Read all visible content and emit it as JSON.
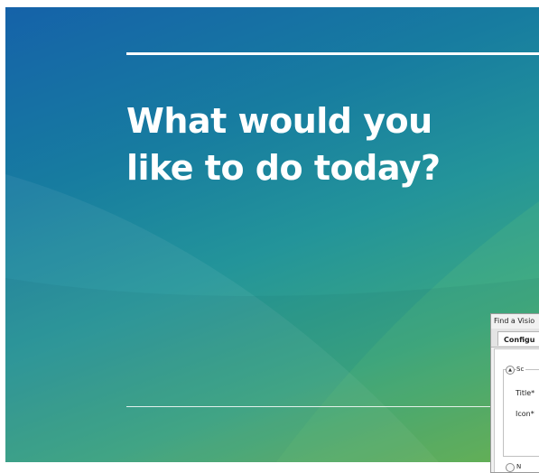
{
  "hero": {
    "headline_line1": "What would you",
    "headline_line2": "like to do today?"
  },
  "dialog": {
    "title": "Find a Visio",
    "tab_label": "Configu",
    "section_legend": "Sc",
    "title_label": "Title*",
    "icon_label": "Icon*",
    "section2_legend": "N",
    "collapse_glyph": "▲"
  },
  "colors": {
    "gradient_top": "#1562a9",
    "gradient_mid": "#23949a",
    "gradient_bottom": "#6cb34f",
    "headline": "#ffffff"
  }
}
